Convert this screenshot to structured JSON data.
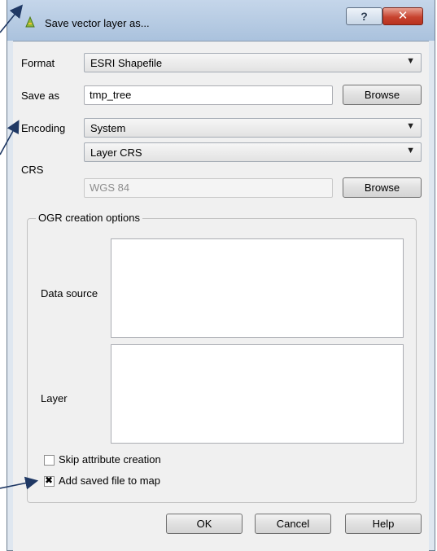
{
  "window": {
    "title": "Save vector layer as...",
    "help_glyph": "?",
    "close_glyph": "✕"
  },
  "format": {
    "label": "Format",
    "value": "ESRI Shapefile"
  },
  "save_as": {
    "label": "Save as",
    "value": "tmp_tree",
    "browse_label": "Browse"
  },
  "encoding": {
    "label": "Encoding",
    "value": "System"
  },
  "crs": {
    "label": "CRS",
    "mode_value": "Layer CRS",
    "crs_value": "WGS 84",
    "browse_label": "Browse"
  },
  "ogr": {
    "group_title": "OGR creation options",
    "data_source_label": "Data source",
    "layer_label": "Layer"
  },
  "options": {
    "skip_attribute_label": "Skip attribute creation",
    "skip_attribute_checked": false,
    "add_to_map_label": "Add saved file to map",
    "add_to_map_checked": true
  },
  "buttons": {
    "ok": "OK",
    "cancel": "Cancel",
    "help": "Help"
  },
  "colors": {
    "annotation_arrow": "#1f3864",
    "close_button": "#c7432f"
  }
}
